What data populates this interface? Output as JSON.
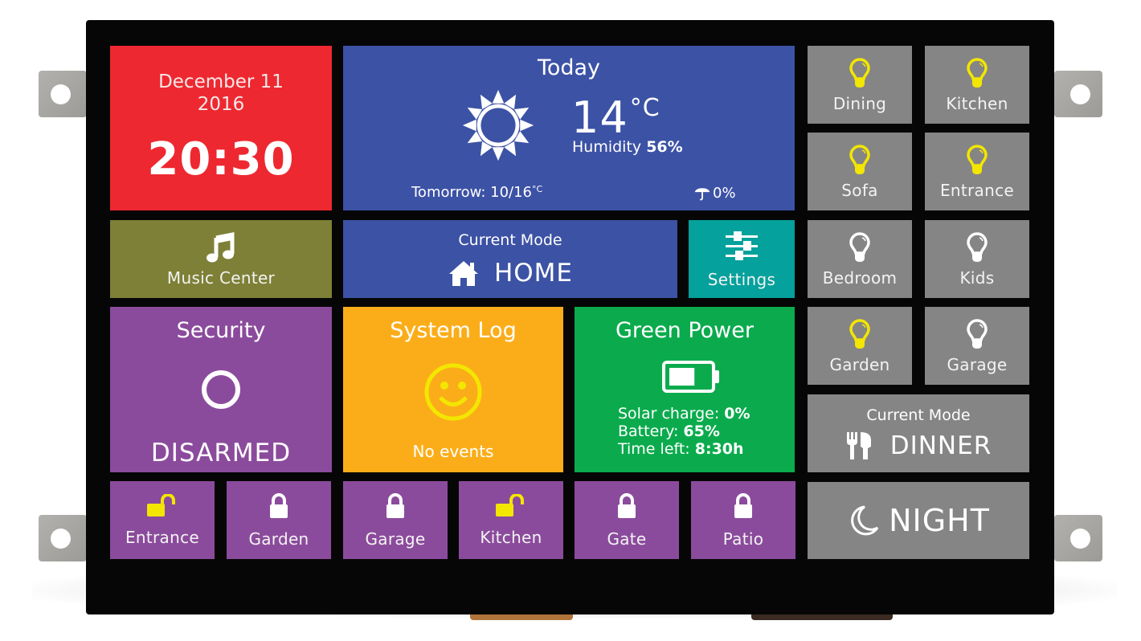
{
  "clock": {
    "date_line1": "December 11",
    "date_line2": "2016",
    "time": "20:30"
  },
  "weather": {
    "title": "Today",
    "icon": "sun-icon",
    "temperature": "14",
    "unit": "°C",
    "humidity_label": "Humidity",
    "humidity_value": "56%",
    "tomorrow_label": "Tomorrow: 10/16",
    "tomorrow_unit": "°C",
    "rain_icon": "umbrella-icon",
    "rain_chance": "0%"
  },
  "music": {
    "icon": "music-note-icon",
    "label": "Music Center"
  },
  "current_mode": {
    "label": "Current Mode",
    "icon": "home-icon",
    "value": "HOME"
  },
  "settings": {
    "icon": "sliders-icon",
    "label": "Settings"
  },
  "security": {
    "title": "Security",
    "icon": "ring-icon",
    "state": "DISARMED"
  },
  "system_log": {
    "title": "System Log",
    "icon": "smiley-icon",
    "status": "No events"
  },
  "green_power": {
    "title": "Green Power",
    "icon": "battery-icon",
    "battery_level": 0.65,
    "solar_label": "Solar charge:",
    "solar_value": "0%",
    "battery_label": "Battery:",
    "battery_value": "65%",
    "time_label": "Time left:",
    "time_value": "8:30h"
  },
  "lights": [
    {
      "label": "Dining",
      "on": true
    },
    {
      "label": "Kitchen",
      "on": true
    },
    {
      "label": "Sofa",
      "on": true
    },
    {
      "label": "Entrance",
      "on": true
    },
    {
      "label": "Bedroom",
      "on": false
    },
    {
      "label": "Kids",
      "on": false
    },
    {
      "label": "Garden",
      "on": true
    },
    {
      "label": "Garage",
      "on": false
    }
  ],
  "locks": [
    {
      "label": "Entrance",
      "locked": false
    },
    {
      "label": "Garden",
      "locked": true
    },
    {
      "label": "Garage",
      "locked": true
    },
    {
      "label": "Kitchen",
      "locked": false
    },
    {
      "label": "Gate",
      "locked": true
    },
    {
      "label": "Patio",
      "locked": true
    }
  ],
  "dinner_mode": {
    "label": "Current Mode",
    "icon": "fork-knife-icon",
    "value": "DINNER"
  },
  "night_mode": {
    "icon": "moon-icon",
    "value": "NIGHT"
  },
  "colors": {
    "on_accent": "#f3e600",
    "off": "#ffffff"
  }
}
